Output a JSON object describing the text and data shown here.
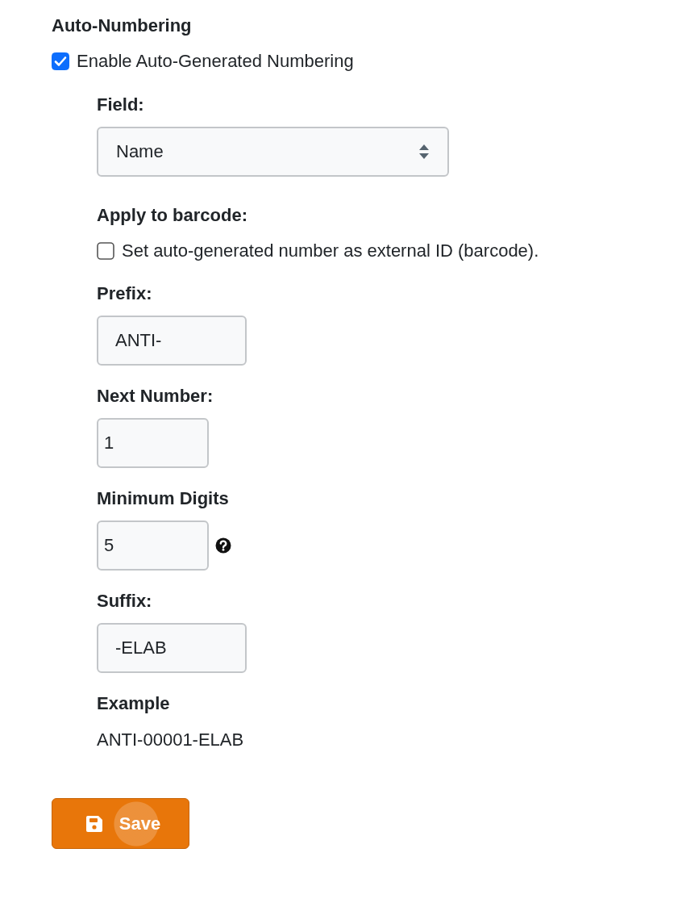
{
  "heading": "Auto-Numbering",
  "enable": {
    "label": "Enable Auto-Generated Numbering",
    "checked": true
  },
  "fields": [
    {
      "kind": "select",
      "label": "Field:",
      "value": "Name"
    },
    {
      "kind": "checkbox",
      "label": "Apply to barcode:",
      "text": "Set auto-generated number as external ID (barcode).",
      "checked": false
    },
    {
      "kind": "text",
      "label": "Prefix:",
      "value": "ANTI-"
    },
    {
      "kind": "number",
      "label": "Next Number:",
      "value": "1",
      "help": false
    },
    {
      "kind": "number",
      "label": "Minimum Digits",
      "value": "5",
      "help": true
    },
    {
      "kind": "text",
      "label": "Suffix:",
      "value": "-ELAB"
    },
    {
      "kind": "example",
      "label": "Example",
      "value": "ANTI-00001-ELAB"
    }
  ],
  "save_button": {
    "label": "Save"
  }
}
